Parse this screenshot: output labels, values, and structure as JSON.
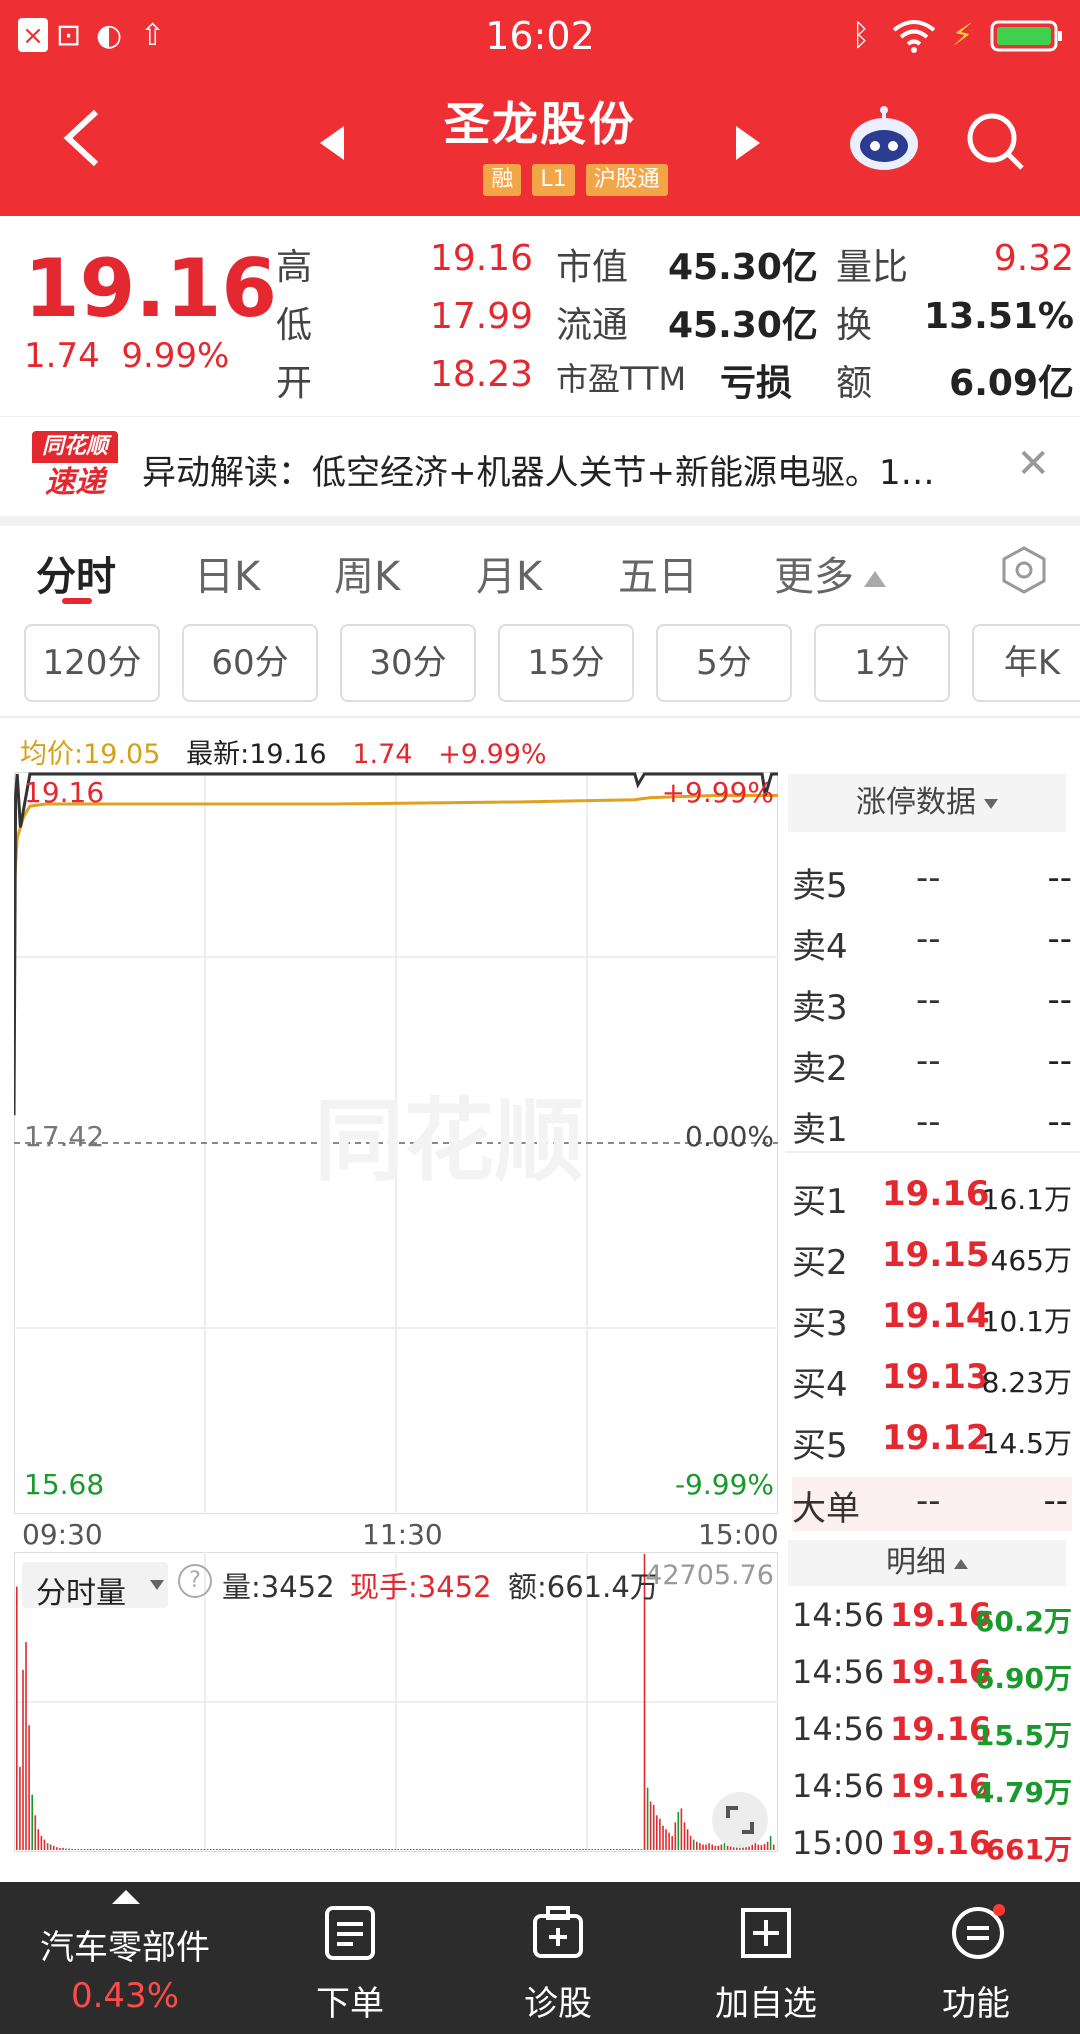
{
  "status_bar": {
    "time": "16:02",
    "left_icons": [
      "close-icon",
      "sim-icon",
      "app-icon",
      "upload-icon"
    ],
    "right_icons": [
      "bluetooth-icon",
      "wifi-icon",
      "charging-icon",
      "battery-icon"
    ]
  },
  "header": {
    "title": "圣龙股份",
    "tags": [
      "融",
      "L1",
      "沪股通"
    ]
  },
  "quote": {
    "price": "19.16",
    "change": "1.74",
    "change_pct": "9.99%",
    "high_label": "高",
    "high": "19.16",
    "low_label": "低",
    "low": "17.99",
    "open_label": "开",
    "open": "18.23",
    "mktcap_label": "市值",
    "mktcap": "45.30亿",
    "float_label": "流通",
    "float": "45.30亿",
    "pe_label": "市盈TTM",
    "pe": "亏损",
    "volratio_label": "量比",
    "volratio": "9.32",
    "turnover_label": "换",
    "turnover": "13.51%",
    "amount_label": "额",
    "amount": "6.09亿"
  },
  "news": {
    "logo_top": "同花顺",
    "logo_bottom": "速递",
    "text": "异动解读：低空经济+机器人关节+新能源电驱。1…"
  },
  "tabs": [
    {
      "label": "分时",
      "active": true
    },
    {
      "label": "日K"
    },
    {
      "label": "周K"
    },
    {
      "label": "月K"
    },
    {
      "label": "五日"
    },
    {
      "label": "更多"
    }
  ],
  "periods": [
    "120分",
    "60分",
    "30分",
    "15分",
    "5分",
    "1分",
    "年K"
  ],
  "chart_legend": {
    "avg": "均价:19.05",
    "latest": "最新:19.16",
    "chg": "1.74",
    "pct": "+9.99%"
  },
  "chart_data": {
    "type": "line",
    "y_top_label": "19.16",
    "y_top_pct": "+9.99%",
    "y_mid_label": "17.42",
    "y_mid_pct": "0.00%",
    "y_bottom_label": "15.68",
    "y_bottom_pct": "-9.99%",
    "ylim": [
      15.68,
      19.16
    ],
    "x_ticks": [
      "09:30",
      "11:30",
      "15:00"
    ],
    "price_series": {
      "name": "最新",
      "x": [
        0,
        0.5,
        1,
        2,
        5,
        30,
        80,
        140,
        195,
        196,
        198,
        205,
        235,
        236,
        238,
        240
      ],
      "y": [
        17.55,
        19.05,
        19.16,
        18.9,
        19.16,
        19.16,
        19.16,
        19.16,
        19.16,
        19.1,
        19.16,
        19.16,
        19.16,
        19.05,
        19.16,
        19.16
      ]
    },
    "avg_series": {
      "name": "均价",
      "x": [
        0,
        1,
        3,
        5,
        10,
        40,
        100,
        160,
        195,
        200,
        220,
        240
      ],
      "y": [
        18.6,
        18.85,
        18.95,
        19.0,
        19.01,
        19.01,
        19.01,
        19.02,
        19.03,
        19.04,
        19.05,
        19.05
      ]
    }
  },
  "volume": {
    "title": "分时量",
    "vol": "量:3452",
    "hand": "现手:3452",
    "amt": "额:661.4万",
    "max": "42705.76"
  },
  "volume_data": {
    "type": "bar",
    "max": 42705.76,
    "values": [
      38000,
      12000,
      26000,
      30000,
      18000,
      8000,
      5000,
      3000,
      2000,
      1500,
      1000,
      800,
      600,
      400,
      300,
      300,
      200,
      200,
      150,
      100,
      100,
      100,
      100,
      100,
      100,
      100,
      100,
      100,
      100,
      100,
      100,
      100,
      100,
      100,
      100,
      100,
      100,
      100,
      100,
      100,
      100,
      100,
      100,
      100,
      100,
      100,
      100,
      100,
      100,
      100,
      100,
      100,
      100,
      100,
      100,
      100,
      100,
      100,
      100,
      100,
      100,
      100,
      100,
      100,
      100,
      100,
      100,
      100,
      100,
      100,
      100,
      100,
      100,
      100,
      100,
      100,
      100,
      100,
      100,
      100,
      100,
      100,
      100,
      100,
      100,
      100,
      100,
      100,
      100,
      100,
      100,
      100,
      100,
      100,
      100,
      100,
      100,
      100,
      100,
      100,
      100,
      100,
      100,
      100,
      100,
      100,
      100,
      100,
      100,
      100,
      100,
      100,
      100,
      100,
      100,
      100,
      100,
      100,
      100,
      100,
      100,
      100,
      100,
      100,
      100,
      100,
      100,
      100,
      100,
      100,
      100,
      100,
      100,
      100,
      100,
      100,
      100,
      100,
      100,
      100,
      100,
      100,
      100,
      100,
      100,
      100,
      100,
      100,
      100,
      100,
      100,
      100,
      100,
      100,
      100,
      100,
      100,
      100,
      100,
      100,
      100,
      100,
      100,
      100,
      100,
      100,
      100,
      100,
      100,
      100,
      100,
      100,
      100,
      100,
      100,
      100,
      100,
      100,
      100,
      100,
      100,
      100,
      100,
      100,
      100,
      100,
      100,
      100,
      100,
      100,
      100,
      100,
      100,
      100,
      100,
      100,
      100,
      100,
      100,
      100,
      100,
      100,
      100,
      100,
      42705,
      9000,
      7000,
      6500,
      5000,
      4500,
      3500,
      3000,
      2500,
      2000,
      4000,
      5500,
      6000,
      4000,
      3000,
      2000,
      1500,
      1200,
      1000,
      800,
      800,
      1000,
      800,
      600,
      600,
      800,
      1000,
      600,
      500,
      400,
      500,
      800,
      600,
      500,
      500,
      800,
      1200,
      800,
      700,
      900,
      1200,
      2000,
      800
    ]
  },
  "order_book": {
    "title": "涨停数据",
    "asks": [
      {
        "label": "卖5",
        "price": "--",
        "vol": "--"
      },
      {
        "label": "卖4",
        "price": "--",
        "vol": "--"
      },
      {
        "label": "卖3",
        "price": "--",
        "vol": "--"
      },
      {
        "label": "卖2",
        "price": "--",
        "vol": "--"
      },
      {
        "label": "卖1",
        "price": "--",
        "vol": "--"
      }
    ],
    "bids": [
      {
        "label": "买1",
        "price": "19.16",
        "vol": "16.1万"
      },
      {
        "label": "买2",
        "price": "19.15",
        "vol": "465万"
      },
      {
        "label": "买3",
        "price": "19.14",
        "vol": "10.1万"
      },
      {
        "label": "买4",
        "price": "19.13",
        "vol": "8.23万"
      },
      {
        "label": "买5",
        "price": "19.12",
        "vol": "14.5万"
      }
    ],
    "big_order": {
      "label": "大单",
      "price": "--",
      "vol": "--"
    },
    "detail_title": "明细",
    "details": [
      {
        "time": "14:56",
        "price": "19.16",
        "vol": "60.2万",
        "color": "#1a9a2c"
      },
      {
        "time": "14:56",
        "price": "19.16",
        "vol": "6.90万",
        "color": "#1a9a2c"
      },
      {
        "time": "14:56",
        "price": "19.16",
        "vol": "15.5万",
        "color": "#1a9a2c"
      },
      {
        "time": "14:56",
        "price": "19.16",
        "vol": "4.79万",
        "color": "#1a9a2c"
      },
      {
        "time": "15:00",
        "price": "19.16",
        "vol": "661万",
        "color": "#e3292f"
      }
    ]
  },
  "bottom_bar": {
    "sector_name": "汽车零部件",
    "sector_pct": "0.43%",
    "items": [
      "下单",
      "诊股",
      "加自选",
      "功能"
    ]
  },
  "colors": {
    "header_bg": "#ee2f34",
    "up": "#e3292f",
    "down": "#1a9a2c",
    "avg_line": "#e0a020"
  }
}
